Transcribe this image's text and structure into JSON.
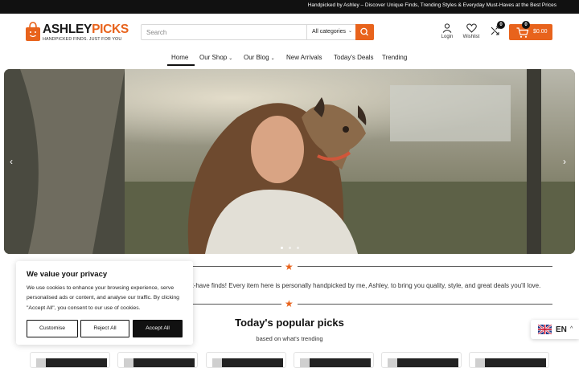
{
  "topbar": {
    "text": "Handpicked by Ashley – Discover Unique Finds, Trending Styles & Everyday Must-Haves at the Best Prices"
  },
  "brand": {
    "name_part1": "ASHLEY",
    "name_part2": "PICKS",
    "tagline": "HANDPICKED FINDS. JUST FOR YOU",
    "accent_color": "#e8631c"
  },
  "search": {
    "placeholder": "Search",
    "category": "All categories",
    "icon": "search-icon"
  },
  "header_actions": {
    "login_label": "Login",
    "wishlist_label": "Wishlist",
    "compare_count": "0",
    "cart_count": "0",
    "cart_total": "$0.00"
  },
  "nav": {
    "items": [
      {
        "label": "Home",
        "active": true
      },
      {
        "label": "Our Shop",
        "has_dropdown": true
      },
      {
        "label": "Our Blog",
        "has_dropdown": true
      },
      {
        "label": "New Arrivals"
      },
      {
        "label": "Today's Deals"
      },
      {
        "label": "Trending"
      }
    ]
  },
  "hero": {
    "prev_icon": "chevron-left-icon",
    "next_icon": "chevron-right-icon",
    "slide_count": 3,
    "active_slide": 1
  },
  "intro": {
    "text": "ust-have finds! Every item here is personally handpicked by me, Ashley, to bring you quality, style, and great deals you'll love."
  },
  "popular": {
    "title": "Today's popular picks",
    "subtitle": "based on what's trending"
  },
  "cookie": {
    "title": "We value your privacy",
    "text": "We use cookies to enhance your browsing experience, serve personalised ads or content, and analyse our traffic. By clicking \"Accept All\", you consent to our use of cookies.",
    "customise_label": "Customise",
    "reject_label": "Reject All",
    "accept_label": "Accept All"
  },
  "language": {
    "code": "EN",
    "flag_icon": "uk-flag-icon"
  }
}
